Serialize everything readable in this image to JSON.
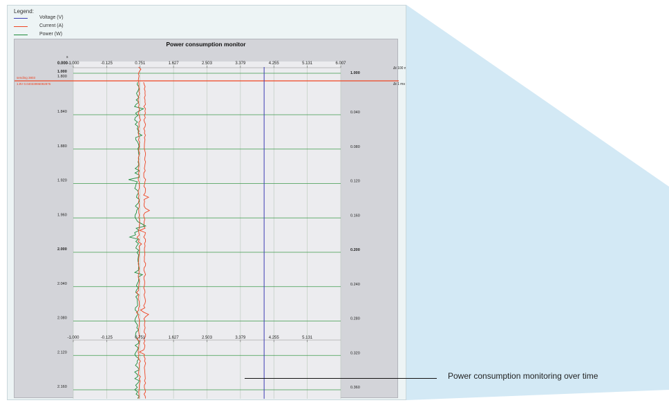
{
  "legend": {
    "title": "Legend:",
    "items": [
      {
        "label": "Voltage (V)",
        "color": "#3b3bb3"
      },
      {
        "label": "Current (A)",
        "color": "#ee4422"
      },
      {
        "label": "Power (W)",
        "color": "#1e8a3a"
      }
    ]
  },
  "chart": {
    "title": "Power consumption monitor",
    "unit_label": "s",
    "top_left_value": "0.000",
    "marker": {
      "label": "sending 3803",
      "value": "1.8V 0.04033996092875"
    },
    "right_labels": {
      "coarse": "Δt 100 ms",
      "fine": "Δt 1 ms"
    },
    "colors": {
      "voltage": "#3b3bb3",
      "current": "#ee4422",
      "power": "#1e8a3a",
      "marker": "#ee4422",
      "grid": "#3b9a4a"
    }
  },
  "chart_data": {
    "type": "line",
    "title": "Power consumption monitor",
    "x_ticks": [
      "-1.000",
      "-0.125",
      "0.751",
      "1.627",
      "2.503",
      "3.379",
      "4.255",
      "5.131",
      "6.007"
    ],
    "x_ticks_lower": [
      "-1.000",
      "-0.125",
      "0.751",
      "1.627",
      "2.503",
      "3.379",
      "4.255",
      "5.131"
    ],
    "xlim": [
      -1.0,
      6.007
    ],
    "coarse_rows": [
      {
        "left": "1.000",
        "right": "1.000"
      },
      {
        "left": "1.800",
        "right": ""
      }
    ],
    "rows": [
      {
        "left": "1.840",
        "right": "0.040"
      },
      {
        "left": "1.880",
        "right": "0.080"
      },
      {
        "left": "1.920",
        "right": "0.120"
      },
      {
        "left": "1.960",
        "right": "0.160"
      },
      {
        "left": "2.000",
        "right": "0.200"
      },
      {
        "left": "2.040",
        "right": "0.240"
      },
      {
        "left": "2.080",
        "right": "0.280"
      },
      {
        "left": "2.120",
        "right": "0.320"
      },
      {
        "left": "2.160",
        "right": "0.360"
      }
    ],
    "series": [
      {
        "name": "Voltage (V)",
        "constant_x": 4.0
      },
      {
        "name": "Current (A)",
        "center_x": 0.87
      },
      {
        "name": "Power (W)",
        "center_x": 0.67
      }
    ]
  },
  "callout": {
    "text": "Power consumption monitoring over time"
  }
}
